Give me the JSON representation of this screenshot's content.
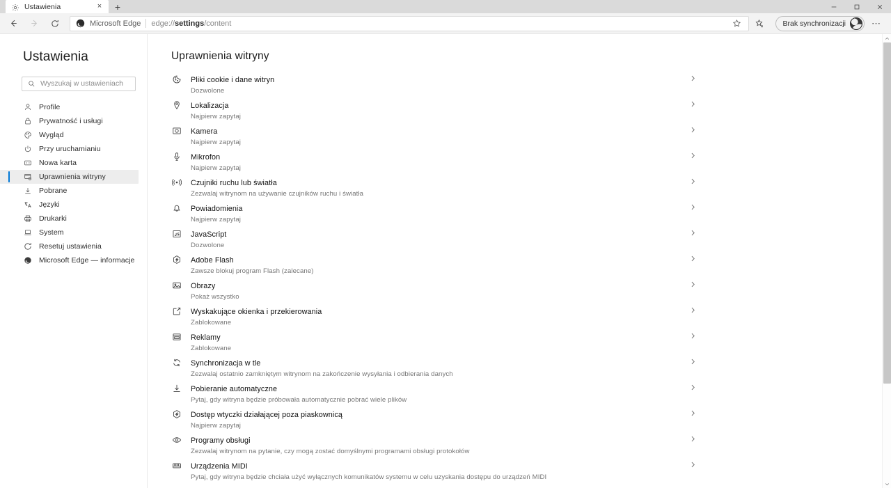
{
  "window": {
    "controls": {
      "minimize": "minimize-icon",
      "maximize": "maximize-icon",
      "close": "close-icon"
    }
  },
  "tabstrip": {
    "tabs": [
      {
        "title": "Ustawienia",
        "favicon": "gear-icon",
        "close_label": "×",
        "active": true
      }
    ],
    "new_tab_label": "+"
  },
  "toolbar": {
    "back_icon": "back-arrow-icon",
    "forward_icon": "forward-arrow-icon",
    "refresh_icon": "refresh-icon",
    "omnibox": {
      "brand_icon": "edge-logo-icon",
      "brand_label": "Microsoft Edge",
      "separator": "|",
      "url_prefix": "edge://",
      "url_bold": "settings",
      "url_suffix": "/content",
      "favorite_icon": "star-icon"
    },
    "collections_icon": "collections-icon",
    "profile": {
      "label": "Brak synchronizacji",
      "avatar_icon": "avatar-icon"
    },
    "more_label": "⋯",
    "more_icon": "more-horizontal-icon"
  },
  "sidebar": {
    "title": "Ustawienia",
    "search": {
      "placeholder": "Wyszukaj w ustawieniach",
      "value": "",
      "icon": "search-icon"
    },
    "items": [
      {
        "label": "Profile",
        "icon": "person-icon",
        "selected": false
      },
      {
        "label": "Prywatność i usługi",
        "icon": "lock-icon",
        "selected": false
      },
      {
        "label": "Wygląd",
        "icon": "palette-icon",
        "selected": false
      },
      {
        "label": "Przy uruchamianiu",
        "icon": "power-icon",
        "selected": false
      },
      {
        "label": "Nowa karta",
        "icon": "newtab-icon",
        "selected": false
      },
      {
        "label": "Uprawnienia witryny",
        "icon": "site-permissions-icon",
        "selected": true
      },
      {
        "label": "Pobrane",
        "icon": "download-icon",
        "selected": false
      },
      {
        "label": "Języki",
        "icon": "languages-icon",
        "selected": false
      },
      {
        "label": "Drukarki",
        "icon": "printer-icon",
        "selected": false
      },
      {
        "label": "System",
        "icon": "laptop-icon",
        "selected": false
      },
      {
        "label": "Resetuj ustawienia",
        "icon": "reset-icon",
        "selected": false
      },
      {
        "label": "Microsoft Edge — informacje",
        "icon": "edge-logo-icon",
        "selected": false
      }
    ]
  },
  "main": {
    "title": "Uprawnienia witryny",
    "chevron_icon": "chevron-right-icon",
    "permissions": [
      {
        "name": "Pliki cookie i dane witryn",
        "status": "Dozwolone",
        "icon": "cookie-icon"
      },
      {
        "name": "Lokalizacja",
        "status": "Najpierw zapytaj",
        "icon": "location-pin-icon"
      },
      {
        "name": "Kamera",
        "status": "Najpierw zapytaj",
        "icon": "camera-icon"
      },
      {
        "name": "Mikrofon",
        "status": "Najpierw zapytaj",
        "icon": "microphone-icon"
      },
      {
        "name": "Czujniki ruchu lub światła",
        "status": "Zezwalaj witrynom na używanie czujników ruchu i światła",
        "icon": "motion-sensor-icon"
      },
      {
        "name": "Powiadomienia",
        "status": "Najpierw zapytaj",
        "icon": "bell-icon"
      },
      {
        "name": "JavaScript",
        "status": "Dozwolone",
        "icon": "javascript-icon"
      },
      {
        "name": "Adobe Flash",
        "status": "Zawsze blokuj program Flash (zalecane)",
        "icon": "flash-icon"
      },
      {
        "name": "Obrazy",
        "status": "Pokaż wszystko",
        "icon": "image-icon"
      },
      {
        "name": "Wyskakujące okienka i przekierowania",
        "status": "Zablokowane",
        "icon": "popup-icon"
      },
      {
        "name": "Reklamy",
        "status": "Zablokowane",
        "icon": "ads-icon"
      },
      {
        "name": "Synchronizacja w tle",
        "status": "Zezwalaj ostatnio zamkniętym witrynom na zakończenie wysyłania i odbierania danych",
        "icon": "sync-icon"
      },
      {
        "name": "Pobieranie automatyczne",
        "status": "Pytaj, gdy witryna będzie próbowała automatycznie pobrać wiele plików",
        "icon": "download-icon"
      },
      {
        "name": "Dostęp wtyczki działającej poza piaskownicą",
        "status": "Najpierw zapytaj",
        "icon": "plugin-icon"
      },
      {
        "name": "Programy obsługi",
        "status": "Zezwalaj witrynom na pytanie, czy mogą zostać domyślnymi programami obsługi protokołów",
        "icon": "handlers-icon"
      },
      {
        "name": "Urządzenia MIDI",
        "status": "Pytaj, gdy witryna będzie chciała użyć wyłącznych komunikatów systemu w celu uzyskania dostępu do urządzeń MIDI",
        "icon": "midi-icon"
      }
    ]
  },
  "scrollbar": {
    "up_arrow": "chevron-up-icon",
    "down_arrow": "chevron-down-icon"
  },
  "colors": {
    "accent": "#0078d7",
    "tabstrip_bg": "#dadada",
    "toolbar_bg": "#f3f3f3",
    "selected_nav_bg": "#ededed"
  }
}
